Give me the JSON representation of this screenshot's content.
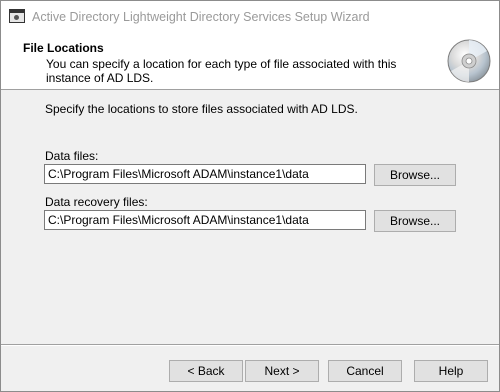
{
  "window": {
    "title": "Active Directory Lightweight Directory Services Setup Wizard"
  },
  "header": {
    "title": "File Locations",
    "description": "You can specify a location for each type of file associated with this instance of AD LDS."
  },
  "main": {
    "instruction": "Specify the locations to store files associated with AD LDS.",
    "data_files": {
      "label": "Data files:",
      "value": "C:\\Program Files\\Microsoft ADAM\\instance1\\data",
      "browse_label": "Browse..."
    },
    "recovery_files": {
      "label": "Data recovery files:",
      "value": "C:\\Program Files\\Microsoft ADAM\\instance1\\data",
      "browse_label": "Browse..."
    }
  },
  "footer": {
    "back_label": "< Back",
    "next_label": "Next >",
    "cancel_label": "Cancel",
    "help_label": "Help"
  },
  "icons": {
    "app": "wizard-window-icon",
    "header": "cd-disc-icon"
  }
}
